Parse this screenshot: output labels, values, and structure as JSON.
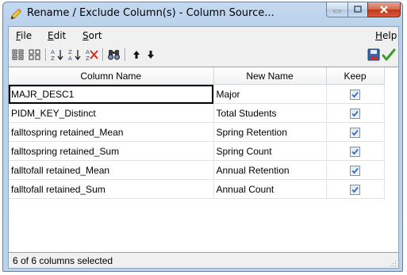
{
  "window": {
    "title": "Rename / Exclude Column(s) - Column Source...",
    "icons": {
      "app": "pencil-rename-icon",
      "minimize": "minimize-icon",
      "maximize": "maximize-icon",
      "close": "close-icon"
    }
  },
  "menu": {
    "file": "File",
    "edit": "Edit",
    "sort": "Sort",
    "help": "Help"
  },
  "toolbar": {
    "icons": [
      "select-all-icon",
      "deselect-all-icon",
      "sort-ascending-icon",
      "sort-descending-icon",
      "clear-sort-icon",
      "find-icon",
      "move-up-icon",
      "move-down-icon",
      "save-icon",
      "ok-checkmark-icon"
    ]
  },
  "table": {
    "headers": {
      "column_name": "Column Name",
      "new_name": "New Name",
      "keep": "Keep"
    },
    "rows": [
      {
        "column_name": "MAJR_DESC1",
        "new_name": "Major",
        "keep": true
      },
      {
        "column_name": "PIDM_KEY_Distinct",
        "new_name": "Total Students",
        "keep": true
      },
      {
        "column_name": "falltospring retained_Mean",
        "new_name": "Spring Retention",
        "keep": true
      },
      {
        "column_name": "falltospring retained_Sum",
        "new_name": "Spring Count",
        "keep": true
      },
      {
        "column_name": "falltofall retained_Mean",
        "new_name": "Annual Retention",
        "keep": true
      },
      {
        "column_name": "falltofall retained_Sum",
        "new_name": "Annual Count",
        "keep": true
      }
    ]
  },
  "status": {
    "text": "6 of 6 columns selected"
  },
  "colors": {
    "check": "#3a6fb8",
    "ok_green": "#3a9a2a",
    "close_red": "#c1371b"
  }
}
